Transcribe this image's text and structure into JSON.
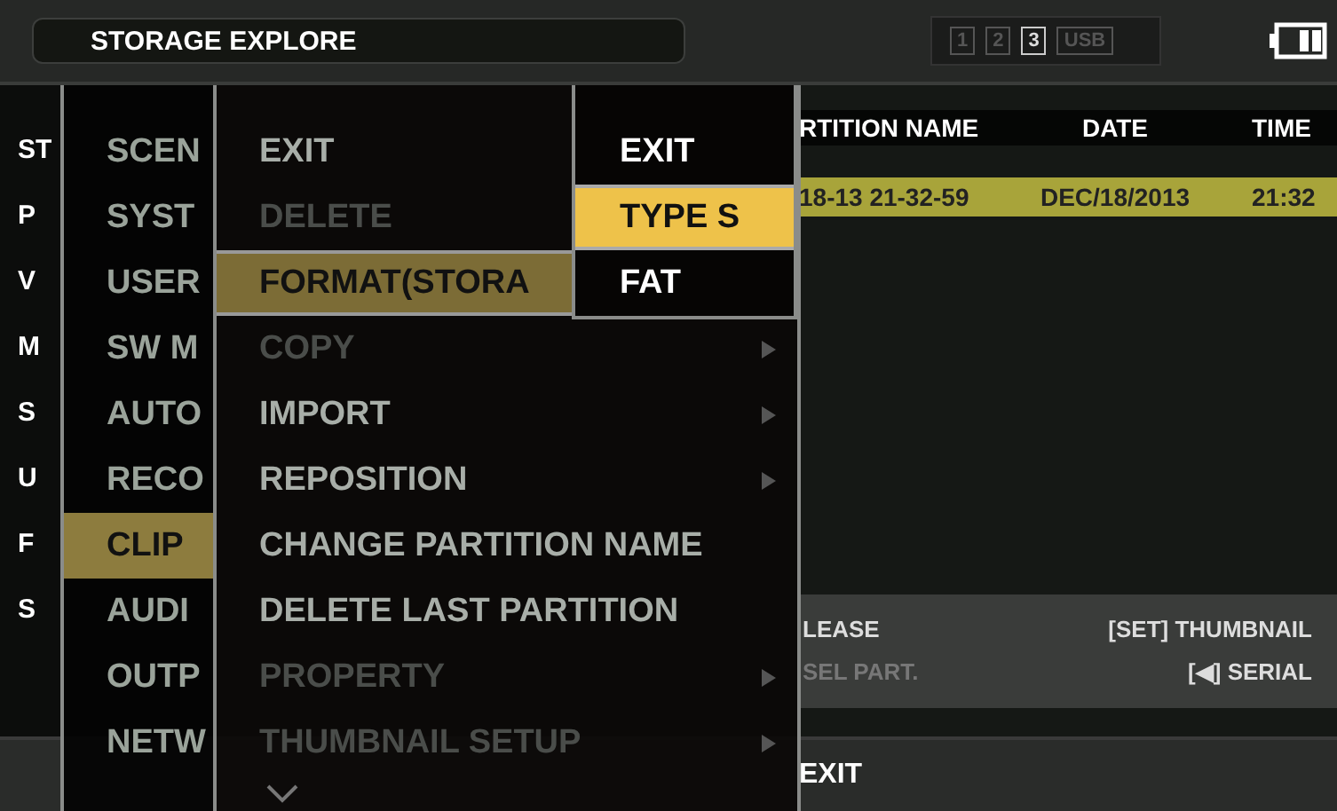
{
  "title": "STORAGE EXPLORE",
  "slots": [
    {
      "label": "1",
      "selected": false
    },
    {
      "label": "2",
      "selected": false
    },
    {
      "label": "3",
      "selected": true
    },
    {
      "label": "USB",
      "selected": false
    }
  ],
  "info_letters": [
    "ST",
    "P",
    "V",
    "M",
    "S",
    "U",
    "F",
    "S"
  ],
  "menu_1": [
    {
      "label": "SCEN",
      "selected": false
    },
    {
      "label": "SYST",
      "selected": false
    },
    {
      "label": "USER",
      "selected": false
    },
    {
      "label": "SW M",
      "selected": false
    },
    {
      "label": "AUTO",
      "selected": false
    },
    {
      "label": "RECO",
      "selected": false
    },
    {
      "label": "CLIP",
      "selected": true
    },
    {
      "label": "AUDI",
      "selected": false
    },
    {
      "label": "OUTP",
      "selected": false
    },
    {
      "label": "NETW",
      "selected": false
    }
  ],
  "menu_2": [
    {
      "label": "EXIT",
      "selected": false,
      "disabled": false,
      "submenu": false
    },
    {
      "label": "DELETE",
      "selected": false,
      "disabled": true,
      "submenu": false
    },
    {
      "label": "FORMAT(STORA",
      "selected": true,
      "disabled": false,
      "submenu": false
    },
    {
      "label": "COPY",
      "selected": false,
      "disabled": true,
      "submenu": true
    },
    {
      "label": "IMPORT",
      "selected": false,
      "disabled": false,
      "submenu": true
    },
    {
      "label": "REPOSITION",
      "selected": false,
      "disabled": false,
      "submenu": true
    },
    {
      "label": "CHANGE PARTITION NAME",
      "selected": false,
      "disabled": false,
      "submenu": false
    },
    {
      "label": "DELETE LAST PARTITION",
      "selected": false,
      "disabled": false,
      "submenu": false
    },
    {
      "label": "PROPERTY",
      "selected": false,
      "disabled": true,
      "submenu": true
    },
    {
      "label": "THUMBNAIL SETUP",
      "selected": false,
      "disabled": true,
      "submenu": true
    }
  ],
  "menu_3": [
    {
      "label": "EXIT",
      "selected": false
    },
    {
      "label": "TYPE S",
      "selected": true
    },
    {
      "label": "FAT",
      "selected": false
    }
  ],
  "table": {
    "columns": [
      "RTITION NAME",
      "DATE",
      "TIME"
    ],
    "rows": [
      {
        "cells": [
          "18-13 21-32-59",
          "DEC/18/2013",
          "21:32"
        ],
        "selected": true
      }
    ]
  },
  "hints": [
    {
      "left": {
        "text": "LEASE",
        "disabled": false
      },
      "right": "[SET] THUMBNAIL"
    },
    {
      "left": {
        "text": "SEL PART.",
        "disabled": true
      },
      "right": "[◀] SERIAL"
    }
  ],
  "status_bar": {
    "text": "EXIT"
  }
}
